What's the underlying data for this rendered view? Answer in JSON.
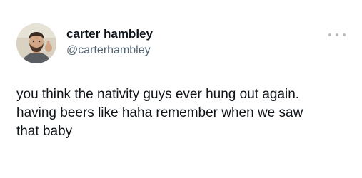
{
  "tweet": {
    "author": {
      "display_name": "carter hambley",
      "handle": "@carterhambley"
    },
    "more_icon": "more-horizontal-icon",
    "text_lines": [
      "you think the nativity guys ever hung out again.",
      "having beers like haha remember when we saw",
      "that baby"
    ]
  },
  "colors": {
    "text_primary": "#0f1419",
    "text_secondary": "#536471",
    "background": "#ffffff"
  }
}
